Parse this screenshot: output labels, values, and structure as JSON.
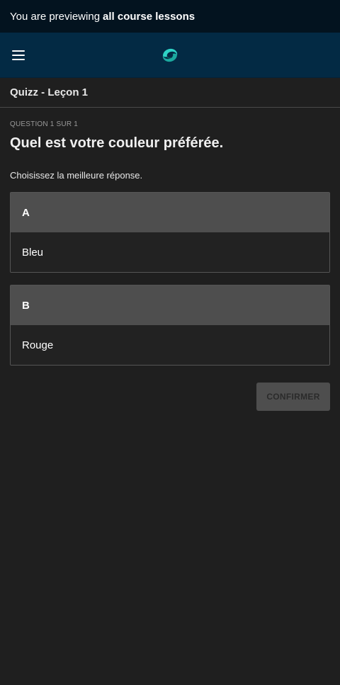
{
  "banner": {
    "prefix": "You are previewing",
    "emphasis": "all course lessons"
  },
  "topbar": {
    "menu_icon": "hamburger-menu-icon",
    "logo_icon": "brand-logo-icon",
    "logo_color": "#2ed3c6"
  },
  "lesson": {
    "title": "Quizz - Leçon 1"
  },
  "question": {
    "counter": "QUESTION 1 SUR 1",
    "title": "Quel est votre couleur préférée.",
    "instructions": "Choisissez la meilleure réponse."
  },
  "choices": [
    {
      "letter": "A",
      "text": "Bleu"
    },
    {
      "letter": "B",
      "text": "Rouge"
    }
  ],
  "actions": {
    "confirm_label": "CONFIRMER"
  },
  "colors": {
    "banner_bg": "#03131f",
    "topbar_bg": "#032a44",
    "page_bg": "#1f1f1f",
    "choice_header_bg": "#4e4e4e",
    "button_bg": "#4e4e4e"
  }
}
